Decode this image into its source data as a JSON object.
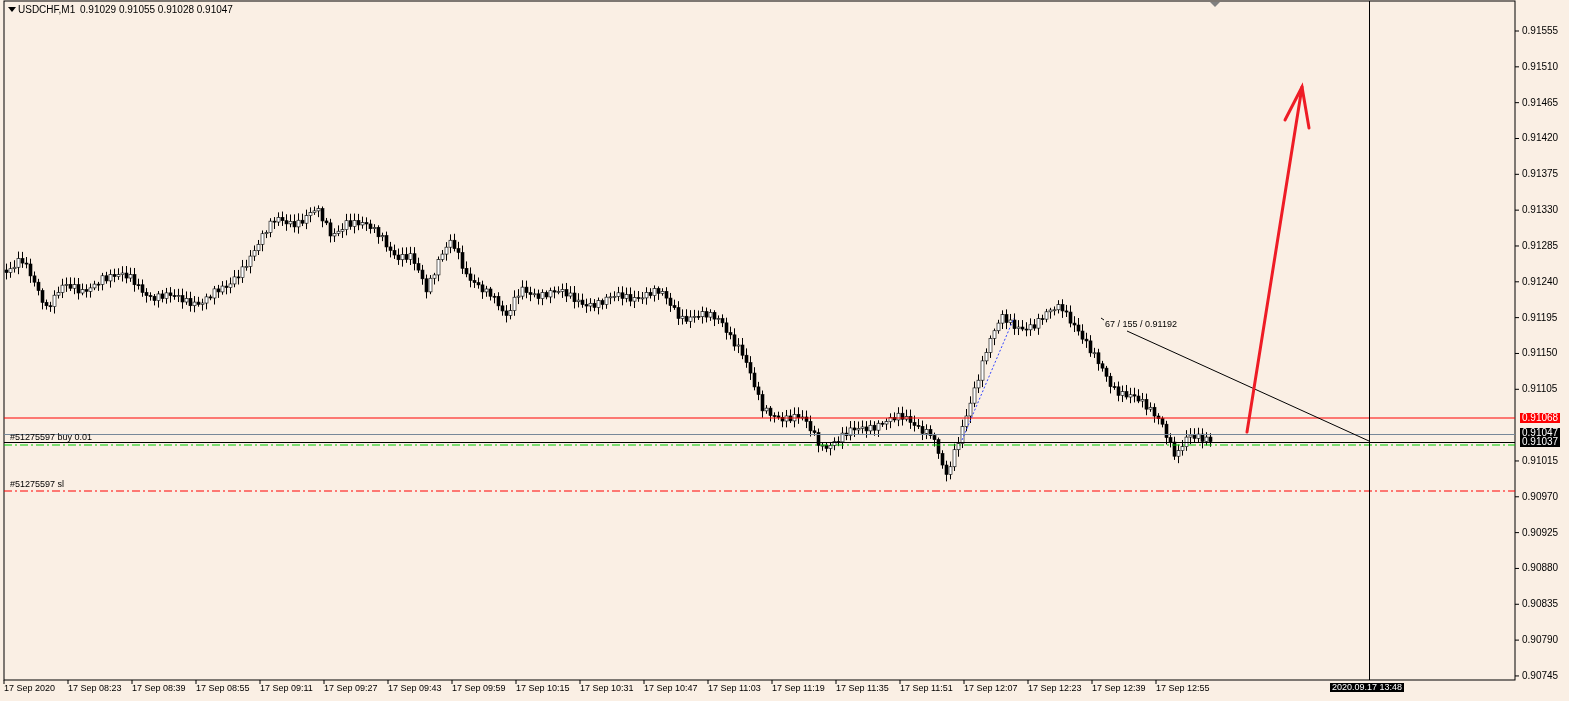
{
  "header": {
    "symbol": "USDCHF,M1",
    "ohlc": "0.91029 0.91055 0.91028 0.91047"
  },
  "price_axis": [
    "0.91555",
    "0.91510",
    "0.91465",
    "0.91420",
    "0.91375",
    "0.91330",
    "0.91285",
    "0.91240",
    "0.91195",
    "0.91150",
    "0.91105",
    "0.91015",
    "0.90970",
    "0.90925",
    "0.90880",
    "0.90835",
    "0.90790",
    "0.90745"
  ],
  "price_tags": [
    {
      "text": "0.91068",
      "kind": "alert"
    },
    {
      "text": "0.91047",
      "kind": "bid"
    },
    {
      "text": "0.91037",
      "kind": "bid"
    }
  ],
  "time_axis": [
    "17 Sep 2020",
    "17 Sep 08:23",
    "17 Sep 08:39",
    "17 Sep 08:55",
    "17 Sep 09:11",
    "17 Sep 09:27",
    "17 Sep 09:43",
    "17 Sep 09:59",
    "17 Sep 10:15",
    "17 Sep 10:31",
    "17 Sep 10:47",
    "17 Sep 11:03",
    "17 Sep 11:19",
    "17 Sep 11:35",
    "17 Sep 11:51",
    "17 Sep 12:07",
    "17 Sep 12:23",
    "17 Sep 12:39",
    "17 Sep 12:55"
  ],
  "cursor_time": "2020.09.17 13:48",
  "order_labels": [
    {
      "text": "#51275597 buy 0.01",
      "kind": "entry"
    },
    {
      "text": "#51275597 sl",
      "kind": "stop"
    }
  ],
  "trendline_label": "67 / 155 / 0.91192"
}
